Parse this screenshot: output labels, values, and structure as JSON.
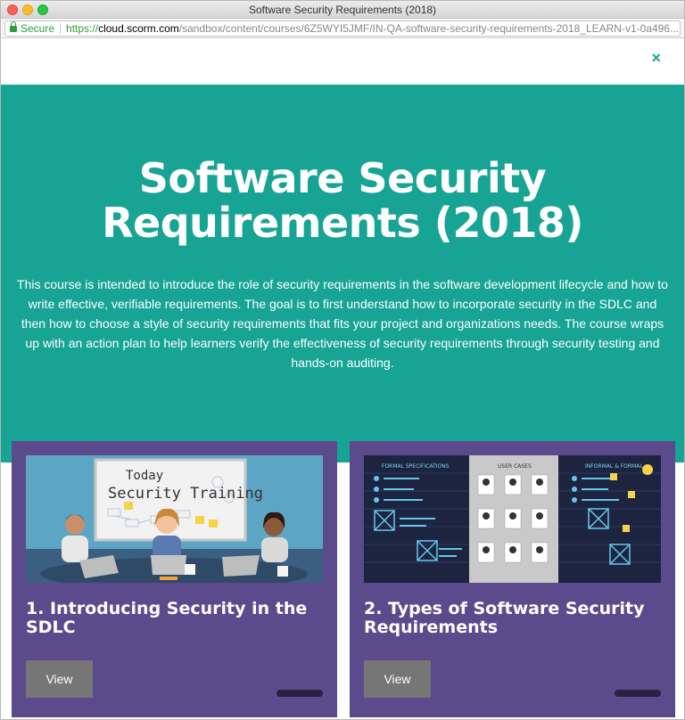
{
  "window": {
    "title": "Software Security Requirements (2018)"
  },
  "urlbar": {
    "secure_label": "Secure",
    "url_scheme": "https://",
    "url_host": "cloud.scorm.com",
    "url_path": "/sandbox/content/courses/6Z5WYI5JMF/IN-QA-software-security-requirements-2018_LEARN-v1-0a496..."
  },
  "course": {
    "title": "Software Security Requirements (2018)",
    "description": "This course is intended to introduce the role of security requirements in the software development lifecycle and how to write effective, verifiable requirements. The goal is to first understand how to incorporate security in the SDLC and then how to choose a style of security requirements that fits your project and organizations needs. The course wraps up with an action plan to help learners verify the effectiveness of security requirements through security testing and hands-on auditing."
  },
  "close_icon": "×",
  "modules": [
    {
      "title": "1. Introducing Security in the SDLC",
      "button_label": "View",
      "thumb_text_1": "Today",
      "thumb_text_2": "Security Training",
      "progress": 0
    },
    {
      "title": "2. Types of Software Security Requirements",
      "button_label": "View",
      "thumb_label_left": "FORMAL SPECIFICATIONS",
      "thumb_label_mid": "USER CASES",
      "thumb_label_right": "INFORMAL & FORMAL",
      "progress": 0
    }
  ],
  "colors": {
    "accent": "#17a494",
    "card": "#5c4b8c",
    "button": "#767676"
  }
}
